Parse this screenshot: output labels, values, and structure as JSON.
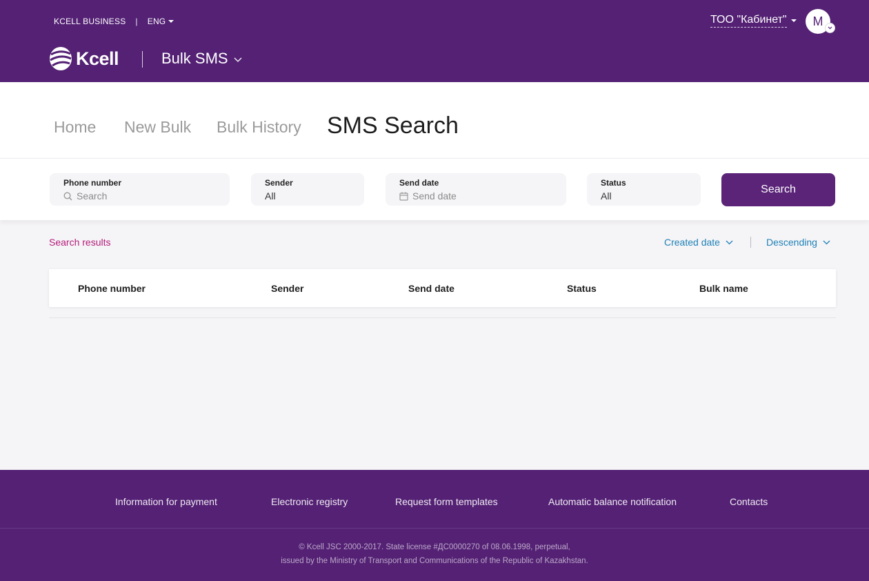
{
  "header": {
    "business_label": "KCELL BUSINESS",
    "separator": "|",
    "language": "ENG",
    "logo_text": "Kcell",
    "product_name": "Bulk SMS",
    "company_name": "ТОО \"Кабинет\"",
    "avatar_initial": "M"
  },
  "tabs": [
    {
      "label": "Home"
    },
    {
      "label": "New Bulk"
    },
    {
      "label": "Bulk History"
    },
    {
      "label": "SMS Search"
    }
  ],
  "active_tab": "SMS Search",
  "filters": {
    "phone": {
      "label": "Phone number",
      "placeholder": "Search"
    },
    "sender": {
      "label": "Sender",
      "value": "All"
    },
    "send_date": {
      "label": "Send date",
      "placeholder": "Send date"
    },
    "status": {
      "label": "Status",
      "value": "All"
    },
    "search_button": "Search"
  },
  "results": {
    "label": "Search results",
    "sort_field": "Created date",
    "sort_order": "Descending",
    "columns": [
      "Phone number",
      "Sender",
      "Send date",
      "Status",
      "Bulk name"
    ],
    "rows": []
  },
  "footer": {
    "links": [
      "Information for payment",
      "Electronic registry",
      "Request form templates",
      "Automatic balance notification",
      "Contacts"
    ],
    "copyright_line1": "© Kcell JSC 2000-2017. State license #ДС0000270 of 08.06.1998, perpetual,",
    "copyright_line2": "issued by the Ministry of Transport and Communications of the Republic of Kazakhstan."
  },
  "colors": {
    "brand_purple": "#542174",
    "button_purple": "#5b2479",
    "accent_magenta": "#b31d7c",
    "link_blue": "#1f82b8"
  }
}
